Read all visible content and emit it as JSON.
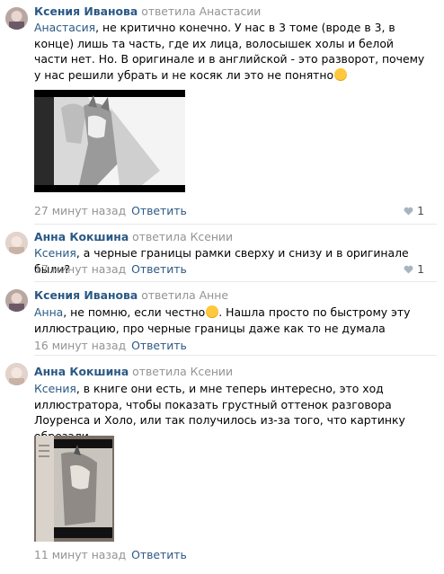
{
  "comments": [
    {
      "author": "Ксения Иванова",
      "reply_to": "ответила Анастасии",
      "mention": "Анастасия",
      "text": ", не критично конечно. У нас в 3 томе (вроде в 3, в конце) лишь та часть, где их лица, волосышек холы и белой части нет. Но. В оригинале и в английской - это разворот, почему у нас решили убрать и не косяк ли это не понятно",
      "time": "27 минут назад",
      "reply_label": "Ответить",
      "likes": "1"
    },
    {
      "author": "Анна Кокшина",
      "reply_to": "ответила Ксении",
      "mention": "Ксения",
      "text": ", а черные границы рамки сверху и снизу и в оригинале были?",
      "time": "17 минут назад",
      "reply_label": "Ответить",
      "likes": "1"
    },
    {
      "author": "Ксения Иванова",
      "reply_to": "ответила Анне",
      "mention": "Анна",
      "text_before": ", не помню, если честно",
      "text_after": ". Нашла просто по быстрому эту иллюстрацию, про черные границы даже как то не думала",
      "time": "16 минут назад",
      "reply_label": "Ответить"
    },
    {
      "author": "Анна Кокшина",
      "reply_to": "ответила Ксении",
      "mention": "Ксения",
      "text": ", в книге они есть, и мне теперь интересно, это ход иллюстратора, чтобы показать грустный оттенок разговора Лоуренса и Холо, или так получилось из-за того, что картинку обрезали",
      "time": "11 минут назад",
      "reply_label": "Ответить"
    }
  ],
  "colors": {
    "link": "#2a5885",
    "muted": "#939393",
    "divider": "#e7e8ec"
  },
  "icons": {
    "like": "heart-icon",
    "emoji": "smile-emoji-icon"
  }
}
